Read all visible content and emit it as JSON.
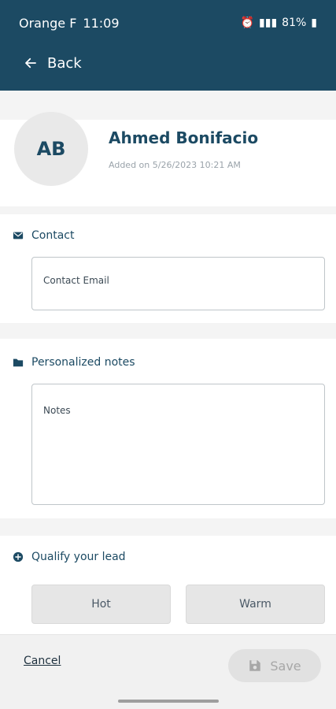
{
  "status_bar": {
    "carrier": "Orange F",
    "time": "11:09",
    "battery": "81%"
  },
  "app_bar": {
    "back_label": "Back"
  },
  "profile": {
    "initials": "AB",
    "name": "Ahmed Bonifacio",
    "added": "Added on 5/26/2023 10:21 AM"
  },
  "contact": {
    "title": "Contact",
    "email_placeholder": "Contact Email"
  },
  "notes": {
    "title": "Personalized notes",
    "placeholder": "Notes"
  },
  "lead": {
    "title": "Qualify your lead",
    "options": [
      "Hot",
      "Warm"
    ]
  },
  "footer": {
    "cancel_label": "Cancel",
    "save_label": "Save"
  },
  "colors": {
    "primary": "#1c4a63",
    "background": "#f4f4f4",
    "button_disabled": "#e1e1e1"
  },
  "icons": {
    "back": "arrow-left-icon",
    "contact": "envelope-icon",
    "notes": "folder-icon",
    "lead": "plus-circle-icon",
    "save": "floppy-disk-icon"
  }
}
